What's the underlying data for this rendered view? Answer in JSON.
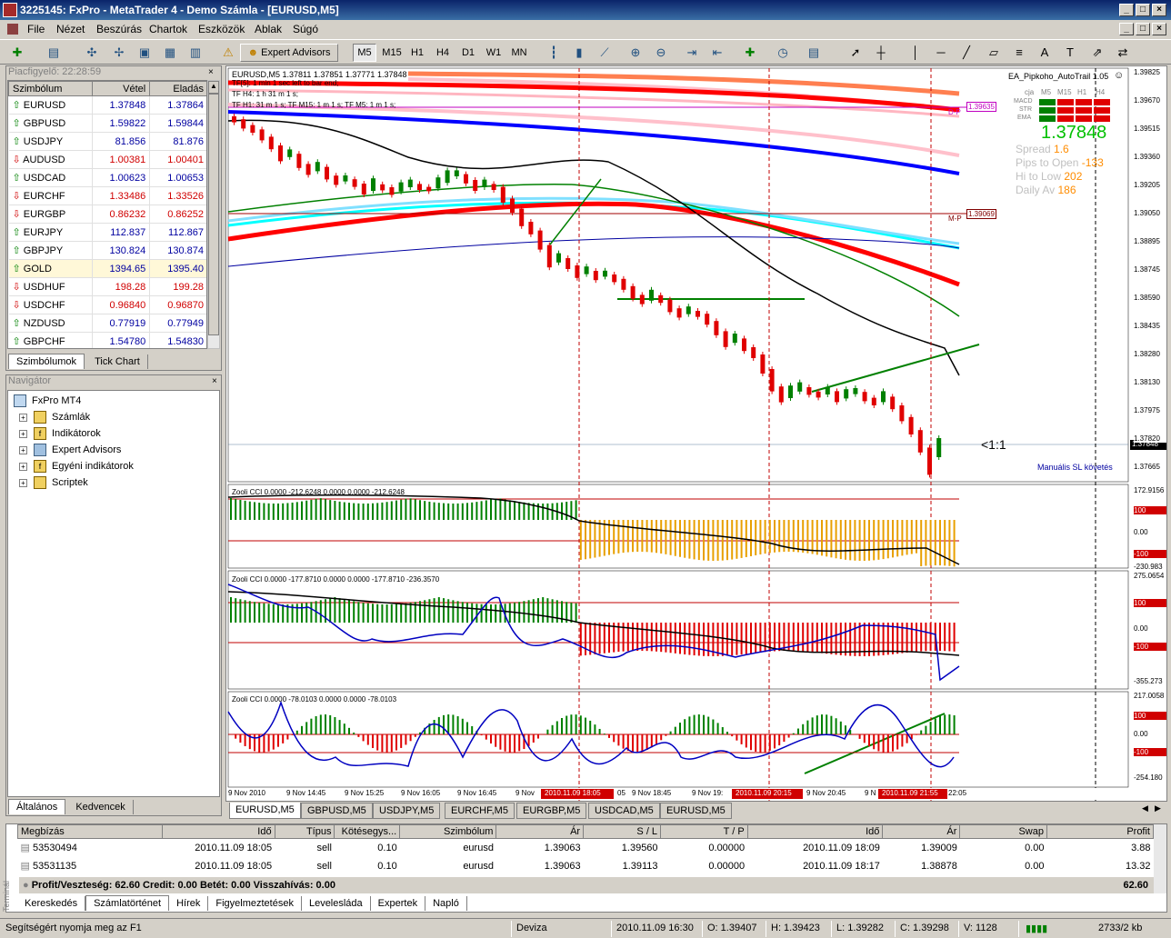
{
  "window": {
    "title": "3225145: FxPro - MetaTrader 4 - Demo Számla - [EURUSD,M5]"
  },
  "menu": [
    "File",
    "Nézet",
    "Beszúrás",
    "Chartok",
    "Eszközök",
    "Ablak",
    "Súgó"
  ],
  "toolbar": {
    "expert_advisors": "Expert Advisors",
    "periods": [
      "M5",
      "M15",
      "H1",
      "H4",
      "D1",
      "W1",
      "MN"
    ]
  },
  "market_watch": {
    "title": "Piacfigyelő: 22:28:59",
    "headers": [
      "Szimbólum",
      "Vétel",
      "Eladás"
    ],
    "rows": [
      {
        "symbol": "EURUSD",
        "bid": "1.37848",
        "ask": "1.37864",
        "dir": "up"
      },
      {
        "symbol": "GBPUSD",
        "bid": "1.59822",
        "ask": "1.59844",
        "dir": "up"
      },
      {
        "symbol": "USDJPY",
        "bid": "81.856",
        "ask": "81.876",
        "dir": "up"
      },
      {
        "symbol": "AUDUSD",
        "bid": "1.00381",
        "ask": "1.00401",
        "dir": "dn"
      },
      {
        "symbol": "USDCAD",
        "bid": "1.00623",
        "ask": "1.00653",
        "dir": "up"
      },
      {
        "symbol": "EURCHF",
        "bid": "1.33486",
        "ask": "1.33526",
        "dir": "dn"
      },
      {
        "symbol": "EURGBP",
        "bid": "0.86232",
        "ask": "0.86252",
        "dir": "dn"
      },
      {
        "symbol": "EURJPY",
        "bid": "112.837",
        "ask": "112.867",
        "dir": "up"
      },
      {
        "symbol": "GBPJPY",
        "bid": "130.824",
        "ask": "130.874",
        "dir": "up"
      },
      {
        "symbol": "GOLD",
        "bid": "1394.65",
        "ask": "1395.40",
        "dir": "up"
      },
      {
        "symbol": "USDHUF",
        "bid": "198.28",
        "ask": "199.28",
        "dir": "dn"
      },
      {
        "symbol": "USDCHF",
        "bid": "0.96840",
        "ask": "0.96870",
        "dir": "dn"
      },
      {
        "symbol": "NZDUSD",
        "bid": "0.77919",
        "ask": "0.77949",
        "dir": "up"
      },
      {
        "symbol": "GBPCHF",
        "bid": "1.54780",
        "ask": "1.54830",
        "dir": "up"
      }
    ],
    "tabs": [
      "Szimbólumok",
      "Tick Chart"
    ]
  },
  "navigator": {
    "title": "Navigátor",
    "root": "FxPro MT4",
    "items": [
      "Számlák",
      "Indikátorok",
      "Expert Advisors",
      "Egyéni indikátorok",
      "Scriptek"
    ],
    "tabs": [
      "Általános",
      "Kedvencek"
    ]
  },
  "chart": {
    "header": "EURUSD,M5  1.37811 1.37851 1.37771 1.37848",
    "tf_lines": [
      "TF[5]: 1 min 1 sec left to bar end;",
      "TF H4: 1 h 31 m 1 s;",
      "TF H1: 31 m 1 s;  TF M15: 1 m 1 s;   TF M5: 1 m 1 s;"
    ],
    "ea_name": "EA_Pipkoho_AutoTrail 1.05",
    "ea_labels": [
      "cja",
      "M5",
      "M15",
      "H1",
      "H4",
      "MACD",
      "STR",
      "EMA"
    ],
    "price": "1.37848",
    "stats": [
      {
        "k": "Spread",
        "v": "1.6"
      },
      {
        "k": "Pips to Open",
        "v": "-133"
      },
      {
        "k": "Hi to Low",
        "v": "202"
      },
      {
        "k": "Daily Av",
        "v": "186"
      }
    ],
    "dp_label": "D-P",
    "dp_value": "1.39635",
    "mp_label": "M-P",
    "mp_value": "1.39069",
    "rr": "<1:1",
    "manual_sl": "Manuális SL követés",
    "price_axis": [
      "1.39825",
      "1.39670",
      "1.39515",
      "1.39360",
      "1.39205",
      "1.39050",
      "1.38895",
      "1.38745",
      "1.38590",
      "1.38435",
      "1.38280",
      "1.38130",
      "1.37975",
      "1.37820",
      "1.37665"
    ],
    "current_price_tag": "1.37848",
    "cci1": {
      "label": "Zooli CCI  0.0000 -212.6248 0.0000 0.0000 -212.6248",
      "axis": [
        "172.9156",
        "100",
        "0.00",
        "-100",
        "-230.983"
      ]
    },
    "cci2": {
      "label": "Zooli CCI  0.0000 -177.8710 0.0000 0.0000 -177.8710 -236.3570",
      "axis": [
        "275.0654",
        "100",
        "0.00",
        "-100",
        "-355.273"
      ]
    },
    "cci3": {
      "label": "Zooli CCI  0.0000 -78.0103 0.0000 0.0000 -78.0103",
      "axis": [
        "217.0058",
        "100",
        "0.00",
        "-100",
        "-254.180"
      ]
    },
    "time_axis": [
      "9 Nov 2010",
      "9 Nov 14:45",
      "9 Nov 15:25",
      "9 Nov 16:05",
      "9 Nov 16:45",
      "9 Nov",
      "9 Nov 18:45",
      "9 Nov 19:",
      "9 Nov 20:45",
      "9 N",
      "22:05"
    ],
    "time_markers": [
      "2010.11.09 18:05",
      "2010.11.09 20:15",
      "2010.11.09 21:55"
    ],
    "time_marker_suffix": "05"
  },
  "chart_tabs": [
    "EURUSD,M5",
    "GBPUSD,M5",
    "USDJPY,M5",
    "EURCHF,M5",
    "EURGBP,M5",
    "USDCAD,M5",
    "EURUSD,M5"
  ],
  "terminal": {
    "headers": [
      "Megbízás",
      "Idő",
      "Típus",
      "Kötésegys...",
      "Szimbólum",
      "Ár",
      "S / L",
      "T / P",
      "Idő",
      "Ár",
      "Swap",
      "Profit"
    ],
    "rows": [
      [
        "53530494",
        "2010.11.09 18:05",
        "sell",
        "0.10",
        "eurusd",
        "1.39063",
        "1.39560",
        "0.00000",
        "2010.11.09 18:09",
        "1.39009",
        "0.00",
        "3.88"
      ],
      [
        "53531135",
        "2010.11.09 18:05",
        "sell",
        "0.10",
        "eurusd",
        "1.39063",
        "1.39113",
        "0.00000",
        "2010.11.09 18:17",
        "1.38878",
        "0.00",
        "13.32"
      ]
    ],
    "summary": "Profit/Veszteség: 62.60  Credit: 0.00  Betét: 0.00  Visszahívás: 0.00",
    "total": "62.60",
    "side_label": "Terminál",
    "tabs": [
      "Kereskedés",
      "Számlatörténet",
      "Hírek",
      "Figyelmeztetések",
      "Levelesláda",
      "Expertek",
      "Napló"
    ]
  },
  "status": {
    "help": "Segítségért nyomja meg az F1",
    "profile": "Deviza",
    "time": "2010.11.09 16:30",
    "open": "O: 1.39407",
    "high": "H: 1.39423",
    "low": "L: 1.39282",
    "close": "C: 1.39298",
    "volume": "V: 1128",
    "traffic": "2733/2 kb"
  }
}
